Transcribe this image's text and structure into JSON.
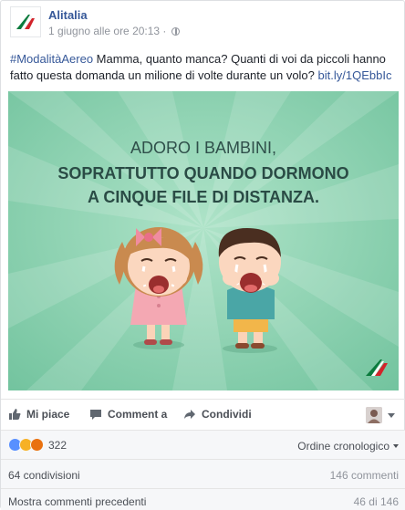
{
  "header": {
    "page_name": "Alitalia",
    "timestamp": "1 giugno alle ore 20:13 ·"
  },
  "post": {
    "hashtag": "#ModalitàAereo",
    "text": " Mamma, quanto manca? Quanti di voi da piccoli hanno fatto questa domanda un milione di volte durante un volo? ",
    "link": "bit.ly/1QEbbIc"
  },
  "image": {
    "line1": "ADORO I BAMBINI,",
    "line2": "SOPRATTUTTO QUANDO DORMONO",
    "line3": "A CINQUE FILE DI DISTANZA.",
    "background": "#8fd4b4",
    "text_color_light": "#2f4f4a",
    "text_color_bold": "#2a4b45"
  },
  "actions": {
    "like": "Mi piace",
    "comment": "Comment a",
    "share": "Condividi"
  },
  "reactions": {
    "count": "322",
    "order_label": "Ordine cronologico"
  },
  "stats": {
    "shares": "64 condivisioni",
    "comments": "146 commenti"
  },
  "more": {
    "label": "Mostra commenti precedenti",
    "count": "46 di 146"
  },
  "colors": {
    "link": "#365899",
    "like_reaction": "#5890ff",
    "haha_reaction": "#f7b125",
    "angry_reaction": "#e9710f"
  }
}
